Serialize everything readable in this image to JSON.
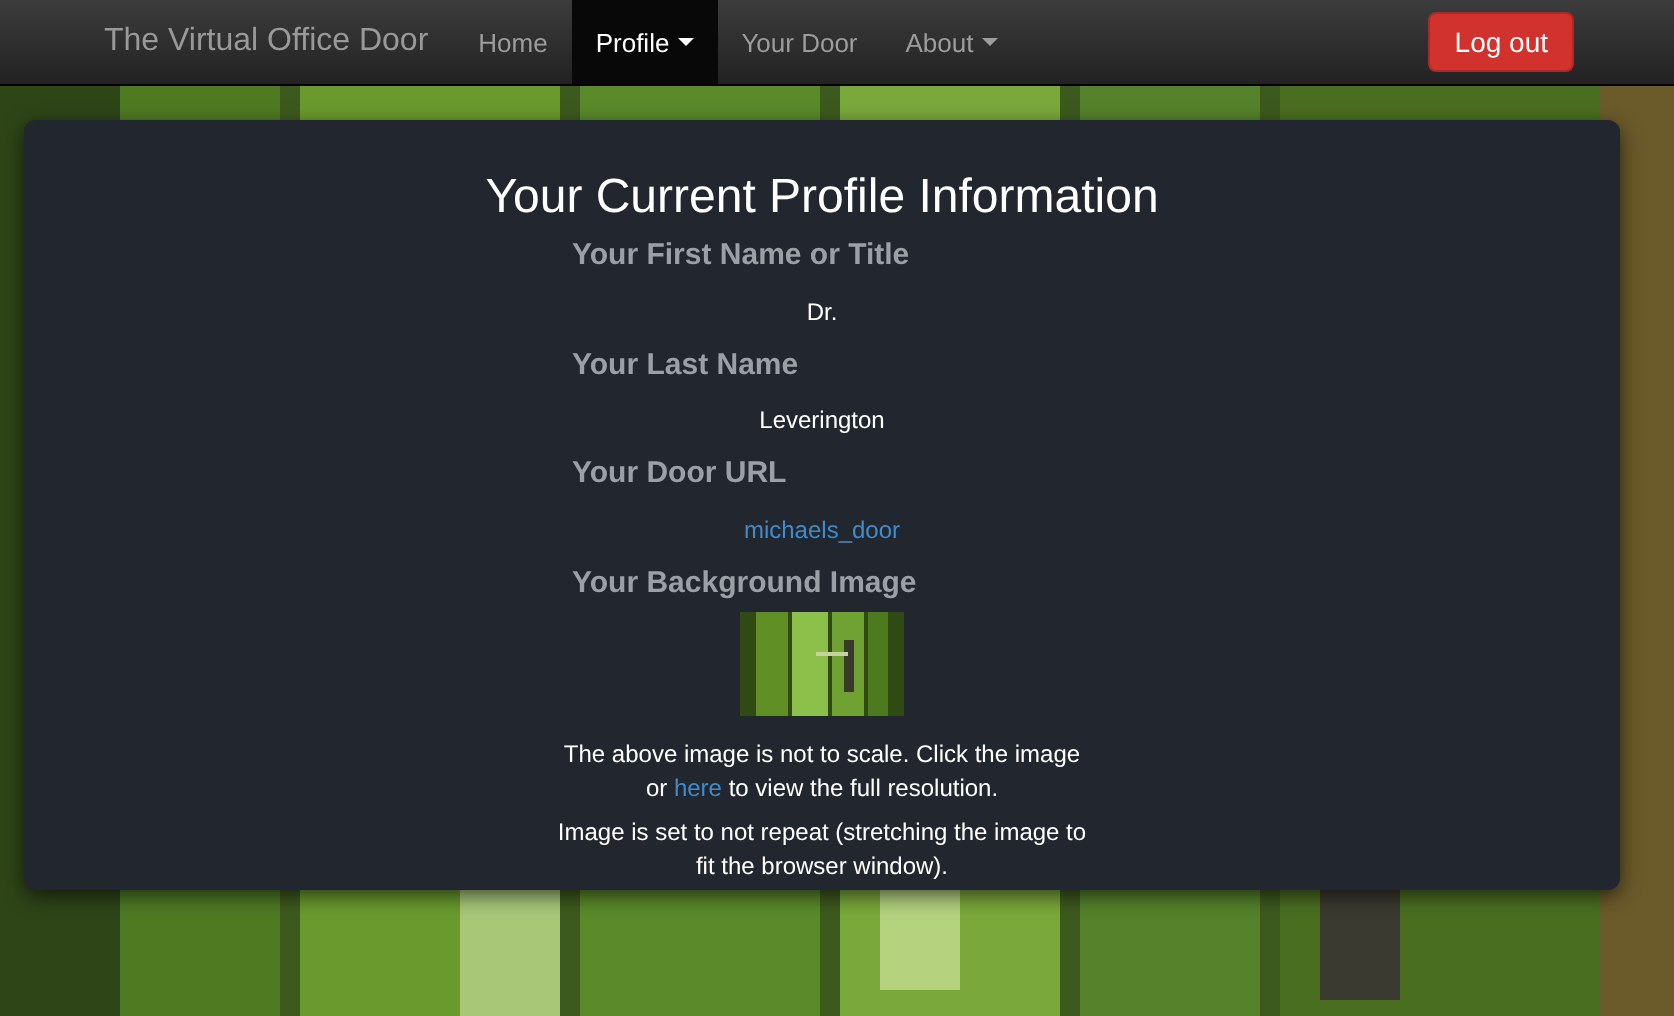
{
  "navbar": {
    "brand": "The Virtual Office Door",
    "items": [
      {
        "label": "Home",
        "kind": "link",
        "selected": false
      },
      {
        "label": "Profile",
        "kind": "dropdown",
        "selected": true
      },
      {
        "label": "Your Door",
        "kind": "link",
        "selected": false
      },
      {
        "label": "About",
        "kind": "dropdown",
        "selected": false
      }
    ],
    "logout_button": "Log out"
  },
  "profile": {
    "title": "Your Current Profile Information",
    "fields": [
      {
        "label": "Your First Name or Title",
        "value": "Dr.",
        "kind": "text"
      },
      {
        "label": "Your Last Name",
        "value": "Leverington",
        "kind": "text"
      },
      {
        "label": "Your Door URL",
        "value": "michaels_door",
        "kind": "link"
      },
      {
        "label": "Your Background Image"
      }
    ],
    "note_before": "The above image is not to scale. Click the image or",
    "note_link": "here",
    "note_after": "to view the full resolution.",
    "repeat_note": "Image is set to not repeat (stretching the image to fit the browser window)."
  }
}
